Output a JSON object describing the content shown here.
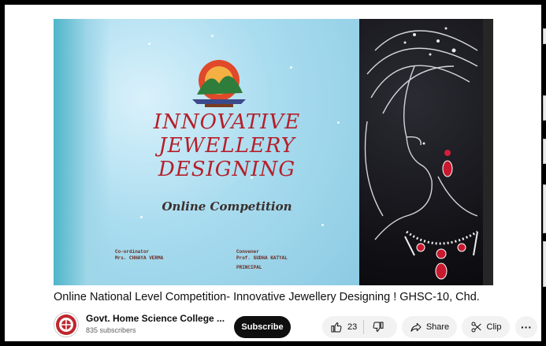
{
  "video": {
    "poster_title_lines": [
      "INNOVATIVE",
      "JEWELLERY",
      "DESIGNING"
    ],
    "poster_subtitle": "Online Competition",
    "coordinator_label": "Co-ordinator",
    "coordinator_name": "Mrs. CHHAYA VERMA",
    "convener_label": "Convener",
    "convener_name": "Prof. SUDHA KATYAL",
    "convener_role": "PRINCIPAL"
  },
  "title": "Online National Level Competition- Innovative Jewellery Designing ! GHSC-10, Chd.",
  "channel": {
    "name": "Govt. Home Science College ...",
    "subscribers": "835 subscribers",
    "avatar_icon": "college-emblem-icon"
  },
  "actions": {
    "subscribe_label": "Subscribe",
    "like_count": "23",
    "share_label": "Share",
    "clip_label": "Clip",
    "more_label": "···"
  },
  "colors": {
    "poster_red": "#b51f2a",
    "subscribe_bg": "#0f0f0f",
    "pill_bg": "#f2f2f2"
  }
}
